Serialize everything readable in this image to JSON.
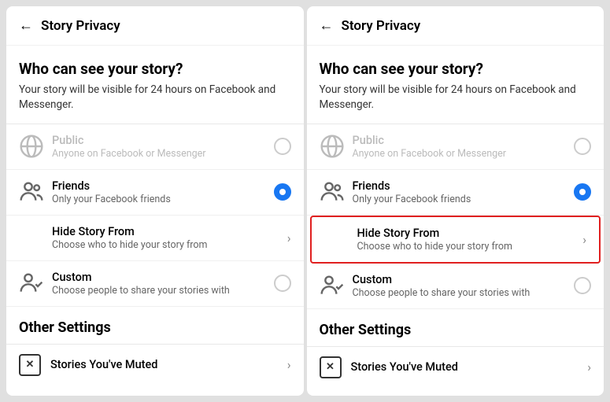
{
  "panels": [
    {
      "id": "left",
      "header": {
        "back_label": "←",
        "title": "Story Privacy"
      },
      "who_heading": "Who can see your story?",
      "who_subtext": "Your story will be visible for 24 hours on Facebook and Messenger.",
      "options": [
        {
          "id": "public",
          "title": "Public",
          "subtitle": "Anyone on Facebook or Messenger",
          "type": "radio",
          "selected": false,
          "disabled": true,
          "icon": "globe"
        },
        {
          "id": "friends",
          "title": "Friends",
          "subtitle": "Only your Facebook friends",
          "type": "radio",
          "selected": true,
          "disabled": false,
          "icon": "friends"
        },
        {
          "id": "hide-story-from",
          "title": "Hide Story From",
          "subtitle": "Choose who to hide your story from",
          "type": "chevron",
          "selected": false,
          "disabled": false,
          "highlighted": false,
          "icon": "none"
        },
        {
          "id": "custom",
          "title": "Custom",
          "subtitle": "Choose people to share your stories with",
          "type": "radio",
          "selected": false,
          "disabled": false,
          "icon": "custom"
        }
      ],
      "other_settings_heading": "Other Settings",
      "stories_muted_label": "Stories You've Muted"
    },
    {
      "id": "right",
      "header": {
        "back_label": "←",
        "title": "Story Privacy"
      },
      "who_heading": "Who can see your story?",
      "who_subtext": "Your story will be visible for 24 hours on Facebook and Messenger.",
      "options": [
        {
          "id": "public",
          "title": "Public",
          "subtitle": "Anyone on Facebook or Messenger",
          "type": "radio",
          "selected": false,
          "disabled": true,
          "icon": "globe"
        },
        {
          "id": "friends",
          "title": "Friends",
          "subtitle": "Only your Facebook friends",
          "type": "radio",
          "selected": true,
          "disabled": false,
          "icon": "friends"
        },
        {
          "id": "hide-story-from",
          "title": "Hide Story From",
          "subtitle": "Choose who to hide your story from",
          "type": "chevron",
          "selected": false,
          "disabled": false,
          "highlighted": true,
          "icon": "none"
        },
        {
          "id": "custom",
          "title": "Custom",
          "subtitle": "Choose people to share your stories with",
          "type": "radio",
          "selected": false,
          "disabled": false,
          "icon": "custom"
        }
      ],
      "other_settings_heading": "Other Settings",
      "stories_muted_label": "Stories You've Muted"
    }
  ]
}
